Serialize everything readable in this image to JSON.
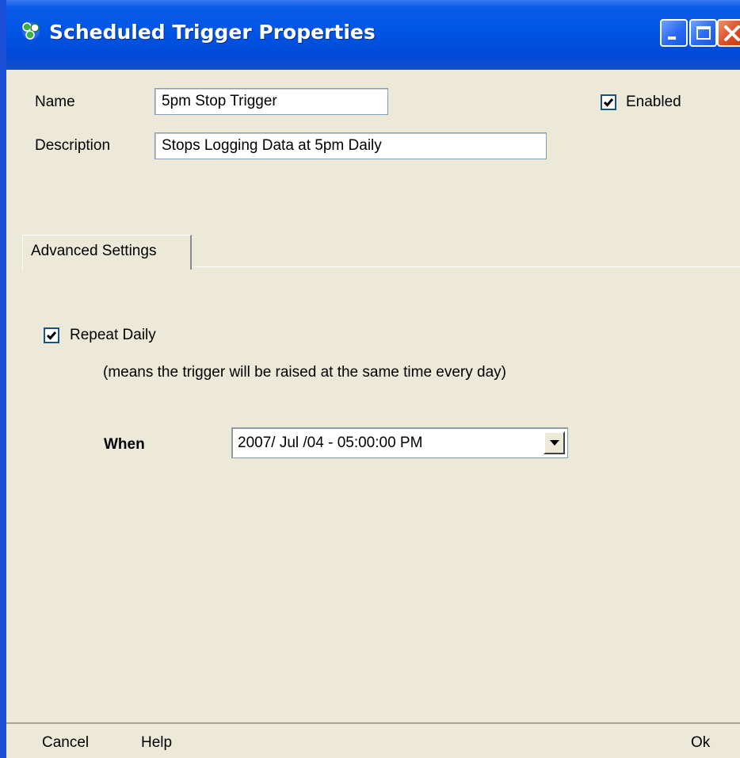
{
  "window": {
    "title": "Scheduled Trigger Properties"
  },
  "form": {
    "name_label": "Name",
    "name_value": "5pm Stop Trigger",
    "description_label": "Description",
    "description_value": "Stops Logging Data at 5pm Daily",
    "enabled_label": "Enabled",
    "enabled_checked": true
  },
  "tabs": [
    {
      "label": "Advanced Settings",
      "active": true
    }
  ],
  "advanced": {
    "repeat_daily_label": "Repeat Daily",
    "repeat_daily_checked": true,
    "repeat_hint": "(means the trigger will be raised at the same time every day)",
    "when_label": "When",
    "when_value": "2007/ Jul /04  -  05:00:00 PM"
  },
  "footer": {
    "cancel_label": "Cancel",
    "help_label": "Help",
    "ok_label": "Ok"
  },
  "colors": {
    "titlebar": "#0055e5",
    "dialog_bg": "#ece9d8",
    "close_button": "#dd4a22"
  }
}
